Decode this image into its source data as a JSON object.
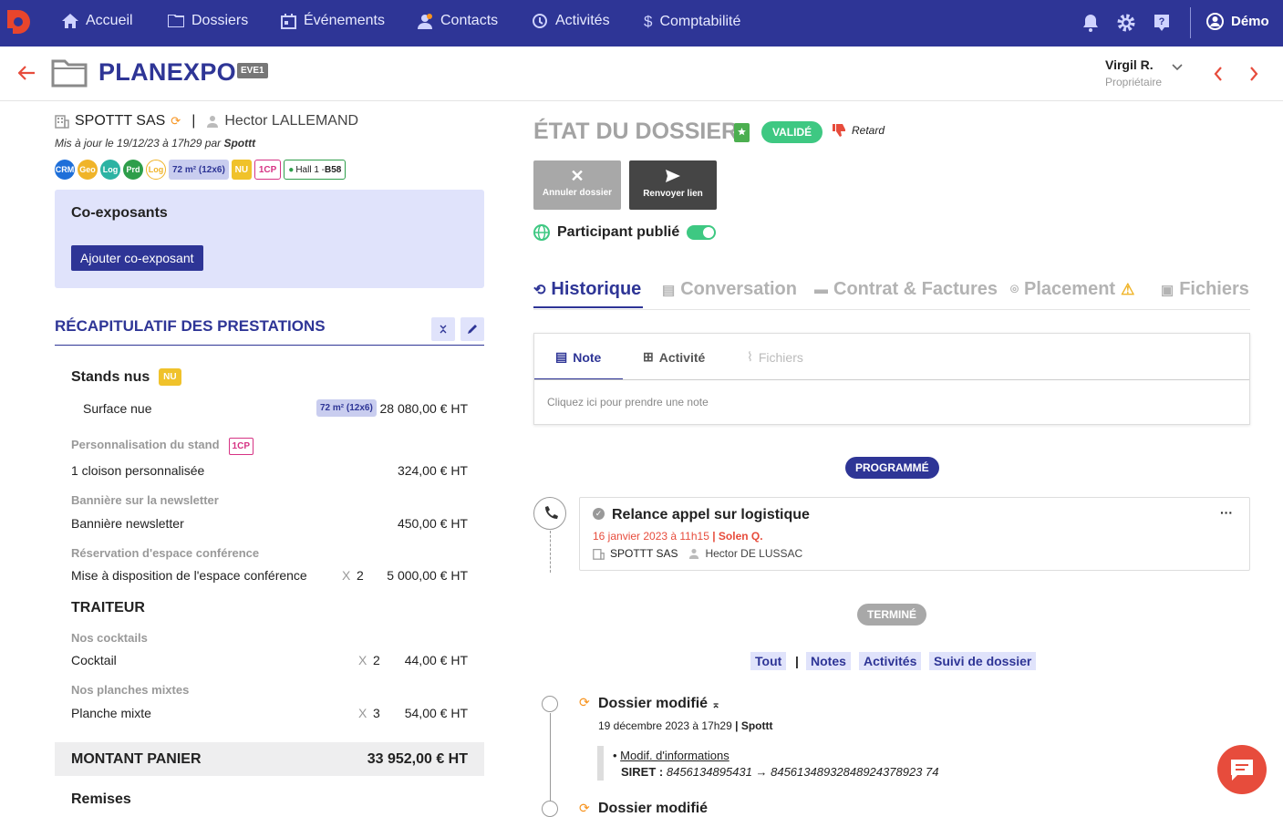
{
  "nav": {
    "home": "Accueil",
    "folders": "Dossiers",
    "events": "Événements",
    "contacts": "Contacts",
    "activities": "Activités",
    "accounting": "Comptabilité",
    "user": "Démo"
  },
  "header": {
    "title": "PLANEXPO",
    "code": "EVE1",
    "owner_name": "Virgil R.",
    "owner_role": "Propriétaire"
  },
  "left": {
    "company": "SPOTTT SAS",
    "contact": "Hector LALLEMAND",
    "separator": "|",
    "updated_prefix": "Mis à jour le 19/12/23 à 17h29 par",
    "updated_by": "Spottt",
    "badges": [
      {
        "label": "CRM",
        "color": "#1e6fd9"
      },
      {
        "label": "Geo",
        "color": "#f0b429"
      },
      {
        "label": "Log",
        "color": "#2bb3a3"
      },
      {
        "label": "Prd",
        "color": "#2e9e4a"
      },
      {
        "label": "Log",
        "color": "#f0b429"
      }
    ],
    "surface_tag": "72 m² (12x6)",
    "nu_tag": "NU",
    "cp_tag": "1CP",
    "hall_tag": "Hall 1 - ",
    "booth": "B58",
    "coexp_title": "Co-exposants",
    "coexp_button": "Ajouter co-exposant",
    "recap_title": "RÉCAPITULATIF DES PRESTATIONS",
    "stands": "Stands nus",
    "stands_tag": "NU",
    "surface_label": "Surface nue",
    "surface_chip": "72 m² (12x6)",
    "surface_amount": "28 080,00 € HT",
    "perso_cat": "Personnalisation du stand",
    "perso_tag": "1CP",
    "perso_label": "1 cloison personnalisée",
    "perso_amount": "324,00 € HT",
    "banner_cat": "Bannière sur la newsletter",
    "banner_label": "Bannière newsletter",
    "banner_amount": "450,00 € HT",
    "conf_cat": "Réservation d'espace conférence",
    "conf_label": "Mise à disposition de l'espace conférence",
    "conf_x": "X",
    "conf_qty": "2",
    "conf_amount": "5 000,00 € HT",
    "traiteur": "TRAITEUR",
    "cocktail_cat": "Nos cocktails",
    "cocktail_label": "Cocktail",
    "cocktail_x": "X",
    "cocktail_qty": "2",
    "cocktail_amount": "44,00 € HT",
    "planche_cat": "Nos planches mixtes",
    "planche_label": "Planche mixte",
    "planche_x": "X",
    "planche_qty": "3",
    "planche_amount": "54,00 € HT",
    "total_label": "MONTANT PANIER",
    "total_amount": "33 952,00 € HT",
    "remises": "Remises"
  },
  "right": {
    "etat": "ÉTAT DU DOSSIER",
    "status": "VALIDÉ",
    "retard": "Retard",
    "cancel": "Annuler dossier",
    "resend": "Renvoyer lien",
    "published": "Participant publié",
    "tabs": [
      "Historique",
      "Conversation",
      "Contrat & Factures",
      "Placement",
      "Fichiers"
    ],
    "note_tabs": [
      "Note",
      "Activité",
      "Fichiers"
    ],
    "note_placeholder": "Cliquez ici pour prendre une note",
    "programmed": "PROGRAMMÉ",
    "task_title": "Relance appel sur logistique",
    "task_date": "16 janvier 2023 à 11h15",
    "task_by": "| Solen Q.",
    "task_company": "SPOTTT SAS",
    "task_contact": "Hector DE LUSSAC",
    "task_more": "···",
    "done": "TERMINÉ",
    "filters": [
      "Tout",
      "|",
      "Notes",
      "Activités",
      "Suivi de dossier"
    ],
    "mod_title": "Dossier modifié",
    "mod_date": "19 décembre 2023 à 17h29",
    "mod_by": "| Spottt",
    "mod_link": "Modif. d'informations",
    "siret_label": "SIRET :",
    "siret_old": "8456134895431",
    "arrow": "→",
    "siret_new": "84561348932848924378923 74",
    "mod_title2": "Dossier modifié"
  }
}
